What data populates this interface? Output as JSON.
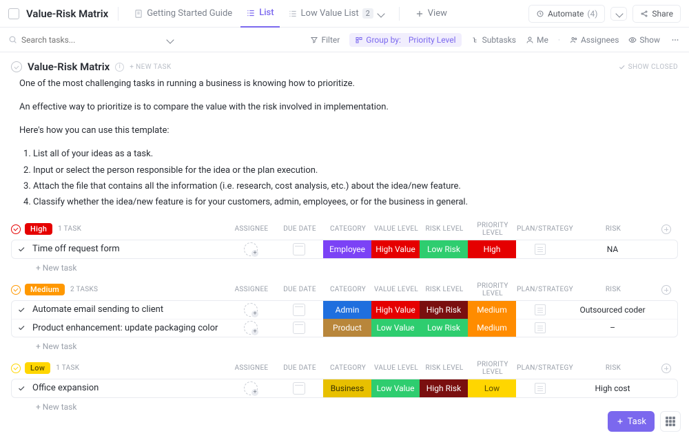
{
  "header": {
    "title": "Value-Risk Matrix",
    "tabs": {
      "guide": "Getting Started Guide",
      "list": "List",
      "lowvalue": "Low Value List",
      "lowvalue_count": "2",
      "view": "View"
    },
    "automate": "Automate",
    "automate_count": "(4)",
    "share": "Share"
  },
  "subbar": {
    "search_placeholder": "Search tasks...",
    "filter": "Filter",
    "group_prefix": "Group by:",
    "group_value": "Priority Level",
    "subtasks": "Subtasks",
    "me": "Me",
    "assignees": "Assignees",
    "show": "Show"
  },
  "list": {
    "title": "Value-Risk Matrix",
    "new_task_label": "+ NEW TASK",
    "show_closed": "SHOW CLOSED"
  },
  "desc": {
    "p1": "One of the most challenging tasks in running a business is knowing how to prioritize.",
    "p2": "An effective way to prioritize is to compare the value with the risk involved in implementation.",
    "p3": "Here's how you can use this template:",
    "li1": "List all of your ideas as a task.",
    "li2": "Input or select the person responsible for the idea or the plan execution.",
    "li3": "Attach the file that contains all the information (i.e. research, cost analysis, etc.) about the idea/new feature.",
    "li4": "Classify whether the idea/new feature is for your customers, admin, employees, or for the business in general."
  },
  "columns": {
    "assignee": "ASSIGNEE",
    "due": "DUE DATE",
    "category": "CATEGORY",
    "value": "VALUE LEVEL",
    "risklvl": "RISK LEVEL",
    "priority": "PRIORITY LEVEL",
    "plan": "PLAN/STRATEGY",
    "risk": "RISK"
  },
  "groups": {
    "high": {
      "label": "High",
      "count": "1 TASK"
    },
    "medium": {
      "label": "Medium",
      "count": "2 TASKS"
    },
    "low": {
      "label": "Low",
      "count": "1 TASK"
    }
  },
  "tasks": {
    "t1": {
      "name": "Time off request form",
      "cat": "Employee",
      "val": "High Value",
      "rsk": "Low Risk",
      "pri": "High",
      "risk": "NA"
    },
    "t2": {
      "name": "Automate email sending to client",
      "cat": "Admin",
      "val": "High Value",
      "rsk": "High Risk",
      "pri": "Medium",
      "risk": "Outsourced coder"
    },
    "t3": {
      "name": "Product enhancement: update packaging color",
      "cat": "Product",
      "val": "Low Value",
      "rsk": "Low Risk",
      "pri": "Medium",
      "risk": "–"
    },
    "t4": {
      "name": "Office expansion",
      "cat": "Business",
      "val": "Low Value",
      "rsk": "High Risk",
      "pri": "Low",
      "risk": "High cost"
    }
  },
  "new_task": "+ New task",
  "fab": {
    "task": "Task"
  }
}
